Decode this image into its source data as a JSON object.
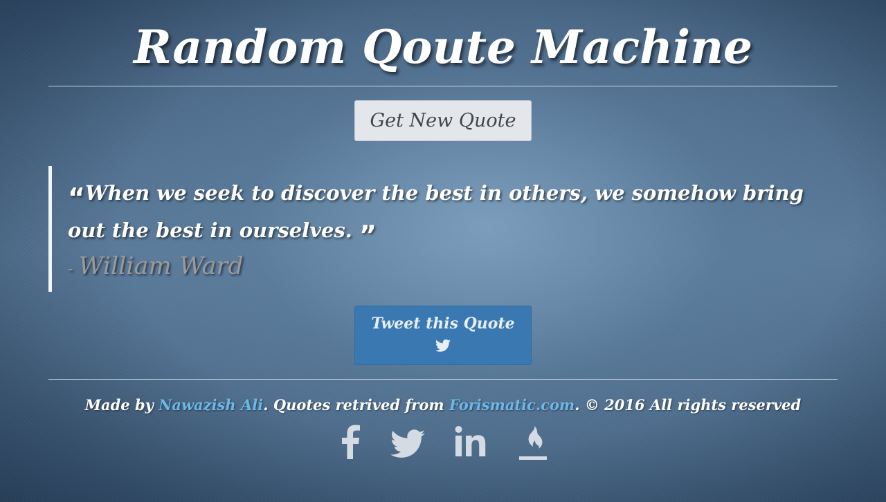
{
  "header": {
    "title": "Random Qoute Machine"
  },
  "controls": {
    "new_quote_label": "Get New Quote",
    "tweet_label": "Tweet this Quote"
  },
  "quote": {
    "open_mark": "“",
    "text": "When we seek to discover the best in others, we somehow bring out the best in ourselves.",
    "close_mark": "”",
    "author_dash": "-",
    "author": "William Ward"
  },
  "footer": {
    "made_by": "Made by ",
    "author_link": "Nawazish Ali",
    "middle_text": ". Quotes retrived from ",
    "source_link": "Forismatic.com",
    "end_text": ". © 2016 All rights reserved"
  },
  "social": [
    {
      "icon": "facebook-icon"
    },
    {
      "icon": "twitter-icon"
    },
    {
      "icon": "linkedin-icon"
    },
    {
      "icon": "freecodecamp-icon"
    }
  ],
  "colors": {
    "background": "#4d6c8b",
    "new_quote_button": "#e3e7ec",
    "tweet_button": "#3a78b2",
    "link": "#6cb8e8",
    "author_text": "#9a9a9a",
    "social_icons": "#d4dbe3"
  }
}
